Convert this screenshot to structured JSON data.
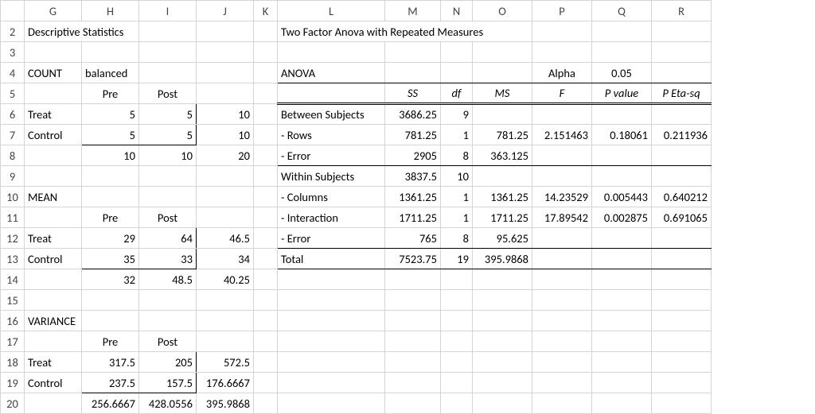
{
  "columns": [
    "G",
    "H",
    "I",
    "J",
    "K",
    "L",
    "M",
    "N",
    "O",
    "P",
    "Q",
    "R"
  ],
  "rowStart": 2,
  "rowEnd": 20,
  "left": {
    "title": "Descriptive Statistics",
    "count_label": "COUNT",
    "balanced": "balanced",
    "mean_label": "MEAN",
    "variance_label": "VARIANCE",
    "pre": "Pre",
    "post": "Post",
    "treat": "Treat",
    "control": "Control",
    "count": {
      "treat_pre": "5",
      "treat_post": "5",
      "treat_tot": "10",
      "ctrl_pre": "5",
      "ctrl_post": "5",
      "ctrl_tot": "10",
      "col_pre": "10",
      "col_post": "10",
      "grand": "20"
    },
    "mean": {
      "treat_pre": "29",
      "treat_post": "64",
      "treat_tot": "46.5",
      "ctrl_pre": "35",
      "ctrl_post": "33",
      "ctrl_tot": "34",
      "col_pre": "32",
      "col_post": "48.5",
      "grand": "40.25"
    },
    "var": {
      "treat_pre": "317.5",
      "treat_post": "205",
      "treat_tot": "572.5",
      "ctrl_pre": "237.5",
      "ctrl_post": "157.5",
      "ctrl_tot": "176.6667",
      "col_pre": "256.6667",
      "col_post": "428.0556",
      "grand": "395.9868"
    }
  },
  "right": {
    "title": "Two Factor Anova with Repeated Measures",
    "anova_label": "ANOVA",
    "alpha_label": "Alpha",
    "alpha_val": "0.05",
    "hdr": {
      "ss": "SS",
      "df": "df",
      "ms": "MS",
      "f": "F",
      "pval": "P value",
      "peta": "P Eta-sq"
    },
    "rows": {
      "between_label": "Between Subjects",
      "between": {
        "ss": "3686.25",
        "df": "9"
      },
      "rows_label": "- Rows",
      "rowsr": {
        "ss": "781.25",
        "df": "1",
        "ms": "781.25",
        "f": "2.151463",
        "p": "0.18061",
        "eta": "0.211936"
      },
      "berr_label": "- Error",
      "berr": {
        "ss": "2905",
        "df": "8",
        "ms": "363.125"
      },
      "within_label": "Within Subjects",
      "within": {
        "ss": "3837.5",
        "df": "10"
      },
      "cols_label": "- Columns",
      "cols": {
        "ss": "1361.25",
        "df": "1",
        "ms": "1361.25",
        "f": "14.23529",
        "p": "0.005443",
        "eta": "0.640212"
      },
      "inter_label": "- Interaction",
      "inter": {
        "ss": "1711.25",
        "df": "1",
        "ms": "1711.25",
        "f": "17.89542",
        "p": "0.002875",
        "eta": "0.691065"
      },
      "werr_label": "- Error",
      "werr": {
        "ss": "765",
        "df": "8",
        "ms": "95.625"
      },
      "total_label": "Total",
      "total": {
        "ss": "7523.75",
        "df": "19",
        "ms": "395.9868"
      }
    }
  }
}
